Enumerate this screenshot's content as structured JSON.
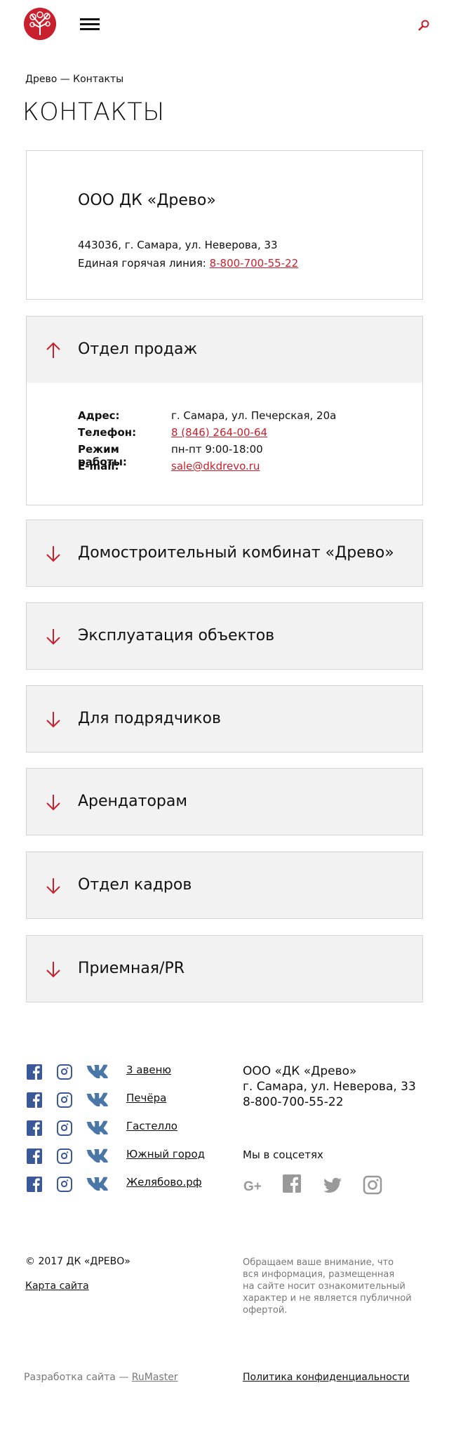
{
  "header": {
    "logo": "tree-logo",
    "menu_icon": "hamburger-icon",
    "search_icon": "search-icon"
  },
  "breadcrumb": "Древо — Контакты",
  "title": "КОНТАКТЫ",
  "company": {
    "name": "ООО ДК «Древо»",
    "address": "443036, г. Самара, ул. Неверова, 33",
    "hotline_label": "Единая горячая линия: ",
    "hotline": "8-800-700-55-22"
  },
  "sections": [
    {
      "title": "Отдел продаж",
      "open": true
    },
    {
      "title": "Домостроительный комбинат «Древо»"
    },
    {
      "title": "Эксплуатация объектов"
    },
    {
      "title": "Для подрядчиков"
    },
    {
      "title": "Арендаторам"
    },
    {
      "title": "Отдел кадров"
    },
    {
      "title": "Приемная/PR"
    }
  ],
  "sales": {
    "address_label": "Адрес:",
    "address": "г. Самара, ул. Печерская, 20а",
    "phone_label": "Телефон:",
    "phone": "8 (846) 264-00-64",
    "hours_label": "Режим работы:",
    "hours": "пн-пт 9:00-18:00",
    "email_label": "E-mail:",
    "email": "sale@dkdrevo.ru"
  },
  "footer": {
    "projects": [
      "3 авеню",
      "Печёра",
      "Гастелло",
      "Южный город",
      "Желябово.рф"
    ],
    "company": "ООО «ДК «Древо»",
    "address": "г. Самара, ул. Неверова, 33",
    "phone": "8-800-700-55-22",
    "social_title": "Мы в соцсетях",
    "copyright": "© 2017 ДК «ДРЕВО»",
    "sitemap": "Карта сайта",
    "notice": [
      "Обращаем ваше внимание, что",
      "вся информация, размещенная",
      "на сайте носит ознакомительный",
      "характер и не является публичной",
      "офертой."
    ],
    "dev_label": "Разработка сайта — ",
    "dev": "RuMaster",
    "privacy": "Политика конфиденциальности"
  },
  "colors": {
    "accent": "#c8202c",
    "social": "#3b5998",
    "gray": "#777777",
    "panel": "#f2f2f2"
  }
}
